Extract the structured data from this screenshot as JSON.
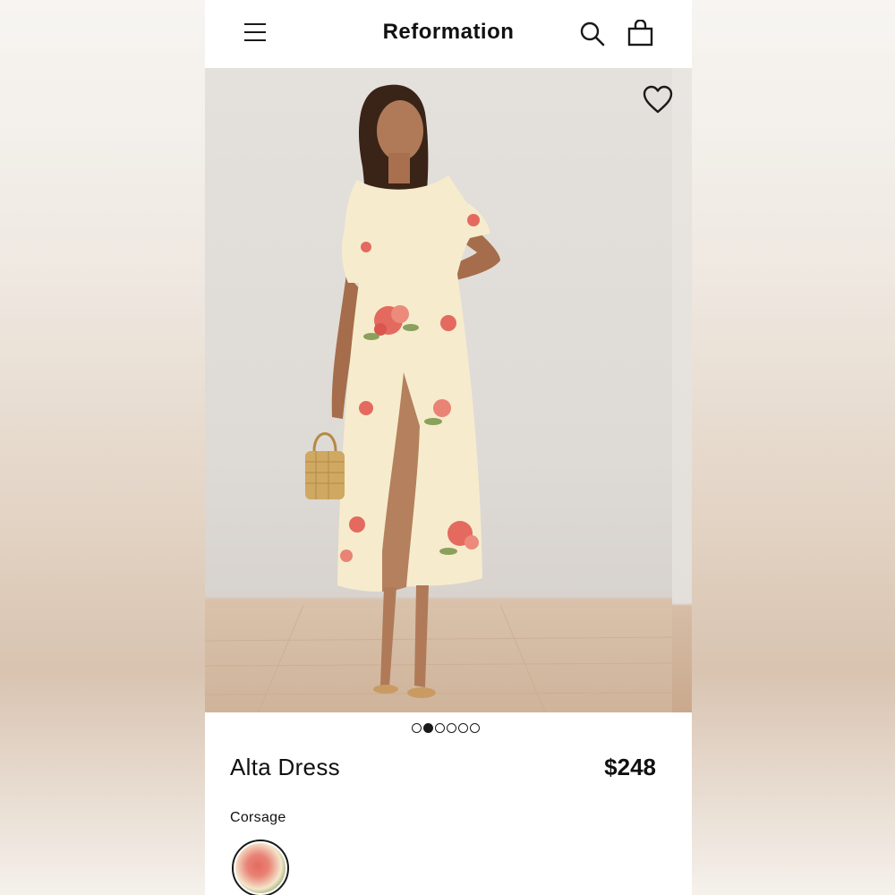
{
  "header": {
    "brand": "Reformation",
    "icons": [
      "menu-icon",
      "search-icon",
      "bag-icon"
    ]
  },
  "gallery": {
    "image_count": 6,
    "active_index": 1,
    "favorite_icon": "heart-icon"
  },
  "product": {
    "name": "Alta Dress",
    "price": "$248",
    "color_name": "Corsage"
  },
  "colors": {
    "text": "#111111",
    "background": "#ffffff",
    "dress": "#f6eccd",
    "floral_accent": "#e46a5f"
  }
}
